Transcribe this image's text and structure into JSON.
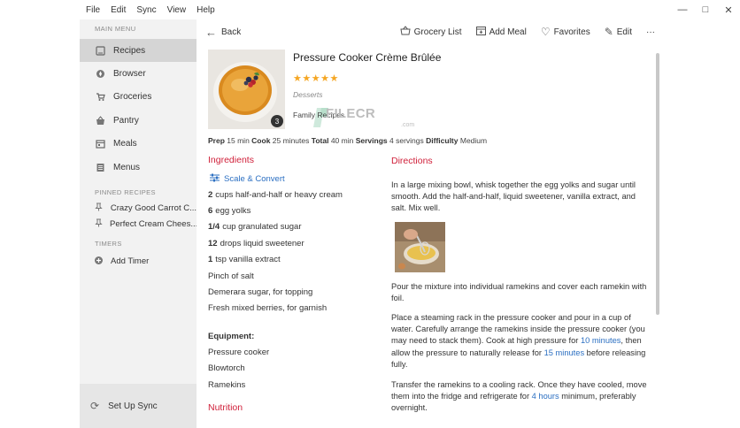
{
  "menubar": {
    "items": [
      "File",
      "Edit",
      "Sync",
      "View",
      "Help"
    ],
    "window_controls": [
      "—",
      "□",
      "✕"
    ]
  },
  "sidebar": {
    "main_menu_label": "MAIN MENU",
    "items": [
      {
        "label": "Recipes",
        "icon": "recipe-icon",
        "active": true
      },
      {
        "label": "Browser",
        "icon": "compass-icon",
        "active": false
      },
      {
        "label": "Groceries",
        "icon": "cart-icon",
        "active": false
      },
      {
        "label": "Pantry",
        "icon": "basket-icon",
        "active": false
      },
      {
        "label": "Meals",
        "icon": "calendar-icon",
        "active": false
      },
      {
        "label": "Menus",
        "icon": "menu-book-icon",
        "active": false
      }
    ],
    "pinned_label": "PINNED RECIPES",
    "pinned": [
      "Crazy Good Carrot C...",
      "Perfect Cream Chees..."
    ],
    "timers_label": "TIMERS",
    "add_timer": "Add Timer",
    "sync_label": "Set Up Sync"
  },
  "toolbar": {
    "back": "Back",
    "grocery_list": "Grocery List",
    "add_meal": "Add Meal",
    "favorites": "Favorites",
    "edit": "Edit",
    "more": "···"
  },
  "recipe": {
    "title": "Pressure Cooker Crème Brûlée",
    "stars": "★★★★★",
    "rating": 5,
    "category": "Desserts",
    "tag": "Family Recipes",
    "photo_count": "3",
    "meta": {
      "prep_label": "Prep",
      "prep": "15 min",
      "cook_label": "Cook",
      "cook": "25 minutes",
      "total_label": "Total",
      "total": "40 min",
      "servings_label": "Servings",
      "servings": "4 servings",
      "difficulty_label": "Difficulty",
      "difficulty": "Medium"
    }
  },
  "watermark": {
    "text": "FILECR",
    "sub": ".com"
  },
  "ingredients": {
    "title": "Ingredients",
    "scale_label": "Scale & Convert",
    "items": [
      {
        "qty": "2",
        "text": "cups half-and-half or heavy cream"
      },
      {
        "qty": "6",
        "text": "egg yolks"
      },
      {
        "qty": "1/4",
        "text": "cup granulated sugar"
      },
      {
        "qty": "12",
        "text": "drops liquid sweetener"
      },
      {
        "qty": "1",
        "text": "tsp vanilla extract"
      },
      {
        "qty": "",
        "text": "Pinch of salt"
      },
      {
        "qty": "",
        "text": "Demerara sugar, for topping"
      },
      {
        "qty": "",
        "text": "Fresh mixed berries, for garnish"
      }
    ],
    "equipment_title": "Equipment:",
    "equipment": [
      "Pressure cooker",
      "Blowtorch",
      "Ramekins"
    ],
    "nutrition_title": "Nutrition"
  },
  "directions": {
    "title": "Directions",
    "step1": "In a large mixing bowl, whisk together the egg yolks and sugar until smooth. Add the half-and-half, liquid sweetener, vanilla extract, and salt. Mix well.",
    "step2": "Pour the mixture into individual ramekins and cover each ramekin with foil.",
    "step3_a": "Place a steaming rack in the pressure cooker and pour in a cup of water. Carefully arrange the ramekins inside the pressure cooker (you may need to stack them). Cook at high pressure for ",
    "step3_link1": "10 minutes",
    "step3_b": ", then allow the pressure to naturally release for ",
    "step3_link2": "15 minutes",
    "step3_c": " before releasing fully.",
    "step4_a": "Transfer the ramekins to a cooling rack. Once they have cooled, move them into the fridge and refrigerate for ",
    "step4_link": "4 hours",
    "step4_b": " minimum, preferably overnight."
  },
  "colors": {
    "accent_red": "#d0203a",
    "link_blue": "#2b6fc2",
    "star": "#f5a623",
    "sidebar_bg": "#f2f2f2",
    "sidebar_active": "#d5d5d5"
  }
}
